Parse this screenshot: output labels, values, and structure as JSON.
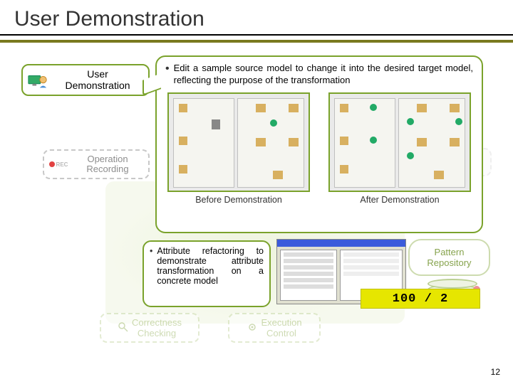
{
  "title": "User Demonstration",
  "boxes": {
    "user_demo": "User\nDemonstration",
    "op_recording": "Operation\nRecording",
    "rec_label": "REC",
    "correctness": "Correctness\nChecking",
    "execution": "Execution\nControl",
    "pattern_repo": "Pattern\nRepository"
  },
  "callout1": {
    "text": "Edit a sample source model to change it into the desired target model, reflecting the purpose of the transformation",
    "before_caption": "Before Demonstration",
    "after_caption": "After Demonstration"
  },
  "callout2": {
    "text": "Attribute refactoring to demonstrate attribute transformation on a concrete model"
  },
  "ratio": "100 / 2",
  "page_number": "12"
}
